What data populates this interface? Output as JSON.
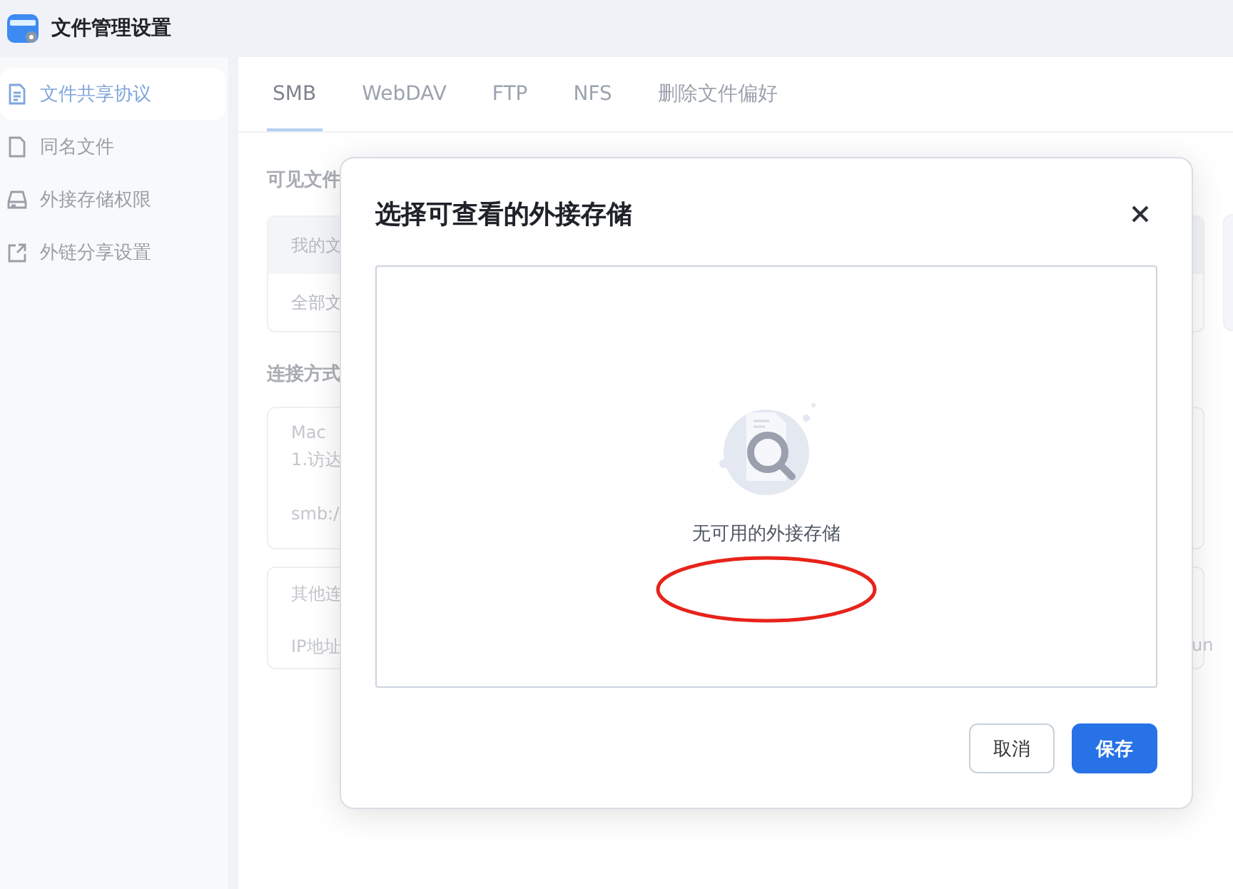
{
  "window": {
    "title": "文件管理设置"
  },
  "sidebar": {
    "items": [
      {
        "label": "文件共享协议",
        "kind": "document",
        "selected": true
      },
      {
        "label": "同名文件",
        "kind": "file",
        "selected": false
      },
      {
        "label": "外接存储权限",
        "kind": "drive",
        "selected": false
      },
      {
        "label": "外链分享设置",
        "kind": "share",
        "selected": false
      }
    ]
  },
  "tabs": [
    {
      "label": "SMB",
      "selected": true
    },
    {
      "label": "WebDAV",
      "selected": false
    },
    {
      "label": "FTP",
      "selected": false
    },
    {
      "label": "NFS",
      "selected": false
    },
    {
      "label": "删除文件偏好",
      "selected": false
    }
  ],
  "content": {
    "visible_files_heading": "可见文件",
    "table_rows": [
      "我的文",
      "全部文"
    ],
    "connection_heading": "连接方式",
    "mac_card": {
      "title": "Mac",
      "lines": [
        "1.访达",
        "smb:/"
      ]
    },
    "other_card": {
      "title": "其他连",
      "line": "IP地址",
      "trailing": "un"
    }
  },
  "dialog": {
    "title": "选择可查看的外接存储",
    "empty_text": "无可用的外接存储",
    "buttons": [
      {
        "label": "取消",
        "kind": "secondary"
      },
      {
        "label": "保存",
        "kind": "primary"
      }
    ]
  }
}
